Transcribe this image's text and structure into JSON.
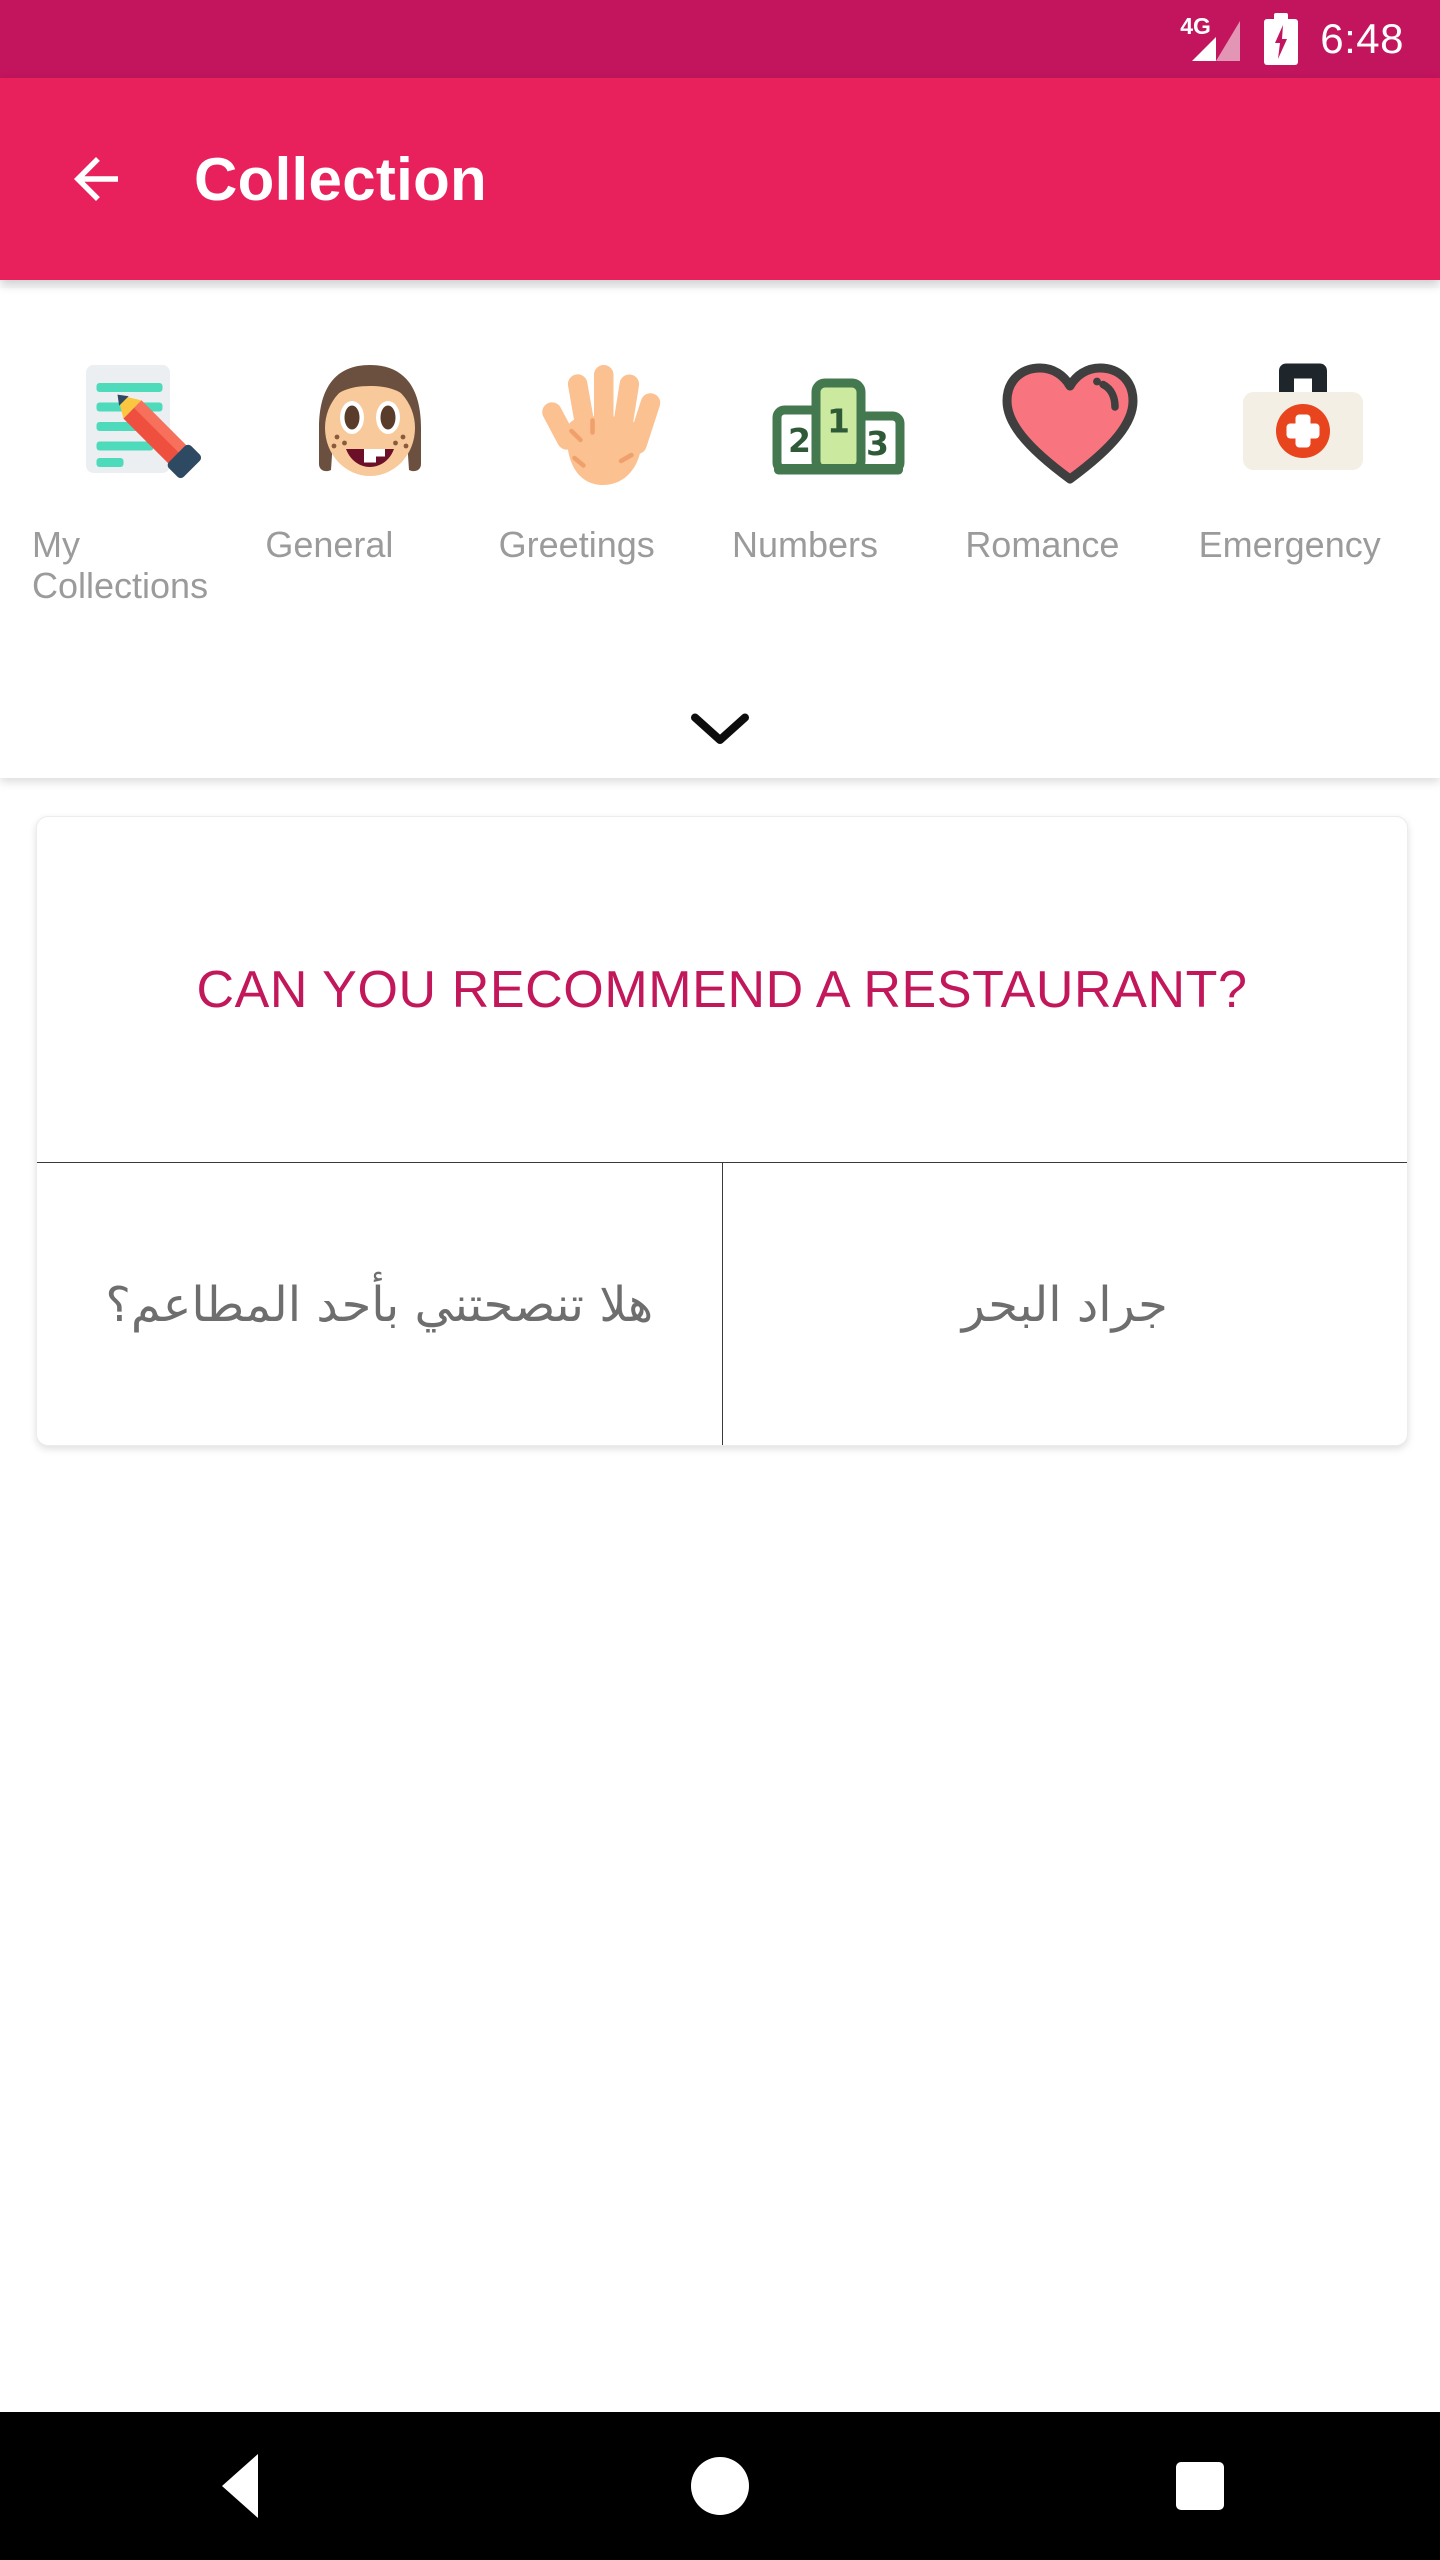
{
  "status_bar": {
    "network_label": "4G",
    "signal_icon": "signal-bars-icon",
    "battery_icon": "battery-charging-icon",
    "time": "6:48",
    "background_color": "#c2155e"
  },
  "app_bar": {
    "back_icon": "arrow-left-icon",
    "title": "Collection",
    "background_color": "#e8215c",
    "text_color": "#ffffff"
  },
  "categories": {
    "expand_icon": "chevron-down-icon",
    "items": [
      {
        "label": "My Collections",
        "icon": "memo-pencil-icon"
      },
      {
        "label": "General",
        "icon": "girl-face-icon"
      },
      {
        "label": "Greetings",
        "icon": "raised-hand-icon"
      },
      {
        "label": "Numbers",
        "icon": "podium-123-icon"
      },
      {
        "label": "Romance",
        "icon": "heart-icon"
      },
      {
        "label": "Emergency",
        "icon": "first-aid-kit-icon"
      }
    ]
  },
  "phrase_card": {
    "english": "CAN YOU RECOMMEND A RESTAURANT?",
    "english_color": "#c2185b",
    "translation_left": "هلا تنصحتني بأحد المطاعم؟",
    "translation_right": "جراد البحر",
    "translation_color": "#6e6e6e"
  },
  "nav_bar": {
    "back_icon": "nav-back-triangle-icon",
    "home_icon": "nav-home-circle-icon",
    "recents_icon": "nav-recents-square-icon",
    "background_color": "#000000"
  }
}
